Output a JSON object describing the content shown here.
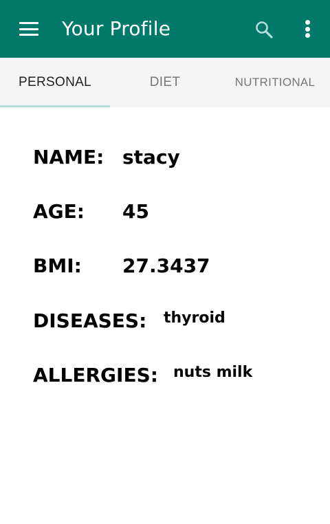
{
  "appbar": {
    "title": "Your Profile",
    "icons": {
      "menu": "hamburger-menu-icon",
      "search": "search-icon",
      "more": "more-vert-icon"
    },
    "background_color": "#00796b"
  },
  "tabs": [
    {
      "label": "PERSONAL",
      "selected": true
    },
    {
      "label": "DIET",
      "selected": false
    },
    {
      "label": "NUTRITIONAL",
      "selected": false
    }
  ],
  "profile": {
    "name": {
      "label": "NAME:",
      "value": "stacy"
    },
    "age": {
      "label": "AGE:",
      "value": "45"
    },
    "bmi": {
      "label": "BMI:",
      "value": "27.3437"
    },
    "diseases": {
      "label": "DISEASES:",
      "value": "thyroid"
    },
    "allergies": {
      "label": "ALLERGIES:",
      "value": "nuts milk"
    }
  }
}
